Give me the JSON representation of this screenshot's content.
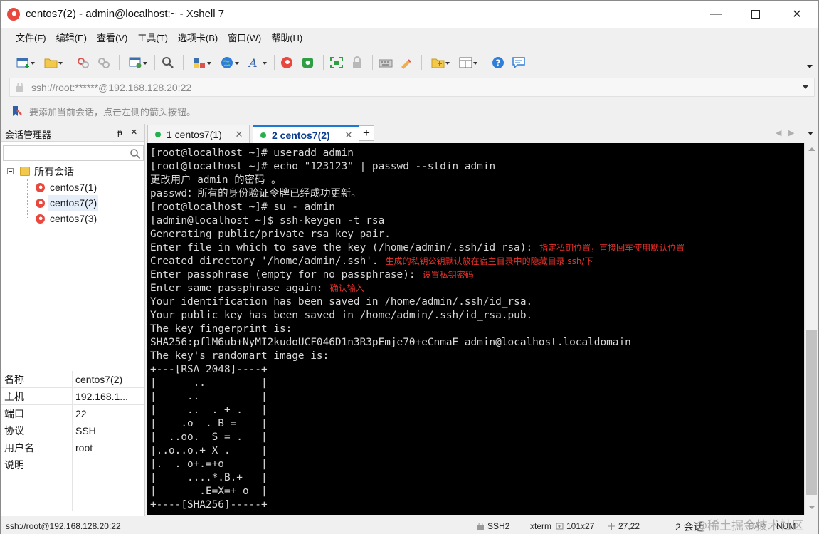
{
  "window": {
    "title": "centos7(2) - admin@localhost:~ - Xshell 7",
    "min_glyph": "—",
    "close_glyph": "✕"
  },
  "menu": [
    "文件(F)",
    "编辑(E)",
    "查看(V)",
    "工具(T)",
    "选项卡(B)",
    "窗口(W)",
    "帮助(H)"
  ],
  "address": {
    "value": "ssh://root:******@192.168.128.20:22"
  },
  "hint": {
    "text": "要添加当前会话，点击左侧的箭头按钮。"
  },
  "session_manager": {
    "title": "会话管理器",
    "pin_glyph": "ᵽ",
    "close_glyph": "×",
    "root_label": "所有会话",
    "sessions": [
      {
        "label": "centos7(1)"
      },
      {
        "label": "centos7(2)"
      },
      {
        "label": "centos7(3)"
      }
    ],
    "properties": [
      {
        "key": "名称",
        "value": "centos7(2)"
      },
      {
        "key": "主机",
        "value": "192.168.1..."
      },
      {
        "key": "端口",
        "value": "22"
      },
      {
        "key": "协议",
        "value": "SSH"
      },
      {
        "key": "用户名",
        "value": "root"
      },
      {
        "key": "说明",
        "value": ""
      }
    ]
  },
  "tabs": [
    {
      "label": "1 centos7(1)",
      "close": "✕"
    },
    {
      "label": "2 centos7(2)",
      "close": "✕"
    }
  ],
  "tab_add": "+",
  "tab_nav": {
    "left": "◀",
    "right": "▶"
  },
  "terminal": {
    "lines": [
      {
        "text": "[root@localhost ~]# useradd admin",
        "note": ""
      },
      {
        "text": "[root@localhost ~]# echo \"123123\" | passwd --stdin admin",
        "note": ""
      },
      {
        "text": "更改用户 admin 的密码 。",
        "note": ""
      },
      {
        "text": "passwd：所有的身份验证令牌已经成功更新。",
        "note": ""
      },
      {
        "text": "[root@localhost ~]# su - admin",
        "note": ""
      },
      {
        "text": "[admin@localhost ~]$ ssh-keygen -t rsa",
        "note": ""
      },
      {
        "text": "Generating public/private rsa key pair.",
        "note": ""
      },
      {
        "text": "Enter file in which to save the key (/home/admin/.ssh/id_rsa):",
        "note": "指定私钥位置，直接回车使用默认位置"
      },
      {
        "text": "Created directory '/home/admin/.ssh'.",
        "note": "生成的私钥公钥默认放在宿主目录中的隐藏目录.ssh/下"
      },
      {
        "text": "Enter passphrase (empty for no passphrase):",
        "note": "设置私钥密码"
      },
      {
        "text": "Enter same passphrase again:",
        "note": "确认输入"
      },
      {
        "text": "Your identification has been saved in /home/admin/.ssh/id_rsa.",
        "note": ""
      },
      {
        "text": "Your public key has been saved in /home/admin/.ssh/id_rsa.pub.",
        "note": ""
      },
      {
        "text": "The key fingerprint is:",
        "note": ""
      },
      {
        "text": "SHA256:pflM6ub+NyMI2kudoUCF046D1n3R3pEmje70+eCnmaE admin@localhost.localdomain",
        "note": ""
      },
      {
        "text": "The key's randomart image is:",
        "note": ""
      },
      {
        "text": "+---[RSA 2048]----+",
        "note": ""
      },
      {
        "text": "|      ..         |",
        "note": ""
      },
      {
        "text": "|     ..          |",
        "note": ""
      },
      {
        "text": "|     ..  . + .   |",
        "note": ""
      },
      {
        "text": "|    .o  . B =    |",
        "note": ""
      },
      {
        "text": "|  ..oo.  S = .   |",
        "note": ""
      },
      {
        "text": "|..o..o.+ X .     |",
        "note": ""
      },
      {
        "text": "|.  . o+.=+o      |",
        "note": ""
      },
      {
        "text": "|     ....*.B.+   |",
        "note": ""
      },
      {
        "text": "|       .E=X=+ o  |",
        "note": ""
      },
      {
        "text": "+----[SHA256]-----+",
        "note": ""
      }
    ]
  },
  "status": {
    "address": "ssh://root@192.168.128.20:22",
    "protocol": "SSH2",
    "term": "xterm",
    "size": "101x27",
    "cursor": "27,22",
    "sessions": "2 会话",
    "cap": "CAP",
    "num": "NUM"
  },
  "watermark": "@稀土掘金技术社区",
  "colors": {
    "accent": "#1a7ad6",
    "terminal_bg": "#000000",
    "terminal_fg": "#d9d9d9",
    "annotation": "#e8312a",
    "session_dot": "#22b14c"
  },
  "icons": [
    "new-session-icon",
    "open-folder-icon",
    "reconnect-icon",
    "disconnect-icon",
    "properties-icon",
    "find-icon",
    "transfer-icon",
    "globe-icon",
    "font-icon",
    "xshell-icon",
    "xftp-icon",
    "fullscreen-icon",
    "lock-icon",
    "keyboard-icon",
    "highlight-icon",
    "compose-icon",
    "layout-icon",
    "help-icon",
    "chat-icon"
  ]
}
